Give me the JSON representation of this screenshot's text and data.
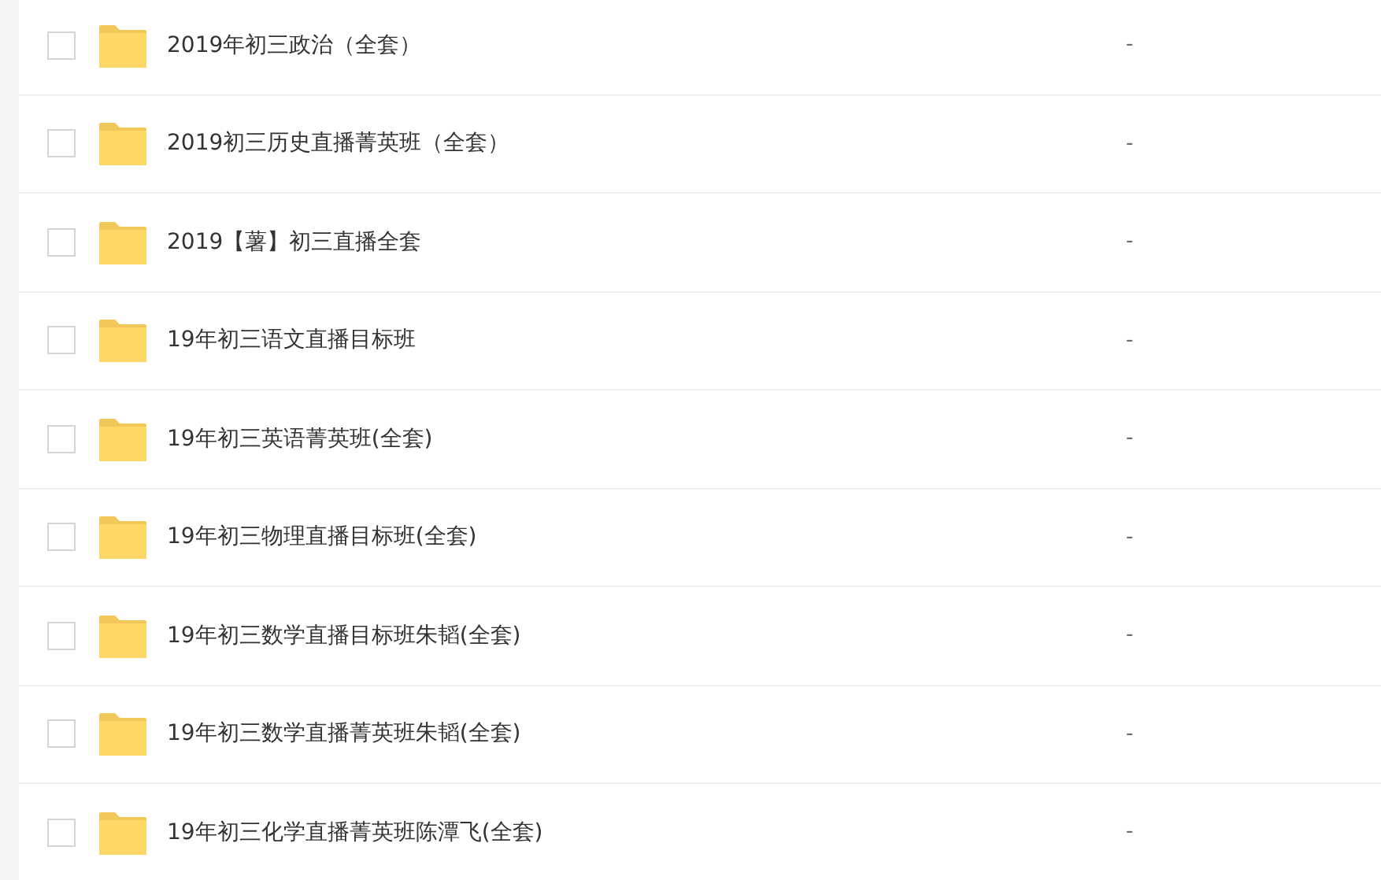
{
  "rows": [
    {
      "name": "2019年初三政治（全套）",
      "checked": false,
      "column_2": "-"
    },
    {
      "name": "2019初三历史直播菁英班（全套）",
      "checked": false,
      "column_2": "-"
    },
    {
      "name": "2019【薯】初三直播全套",
      "checked": false,
      "column_2": "-"
    },
    {
      "name": "19年初三语文直播目标班",
      "checked": false,
      "column_2": "-"
    },
    {
      "name": "19年初三英语菁英班(全套)",
      "checked": false,
      "column_2": "-"
    },
    {
      "name": "19年初三物理直播目标班(全套)",
      "checked": false,
      "column_2": "-"
    },
    {
      "name": "19年初三数学直播目标班朱韬(全套)",
      "checked": false,
      "column_2": "-"
    },
    {
      "name": "19年初三数学直播菁英班朱韬(全套)",
      "checked": false,
      "column_2": "-"
    },
    {
      "name": "19年初三化学直播菁英班陈潭飞(全套)",
      "checked": false,
      "column_2": "-"
    }
  ]
}
